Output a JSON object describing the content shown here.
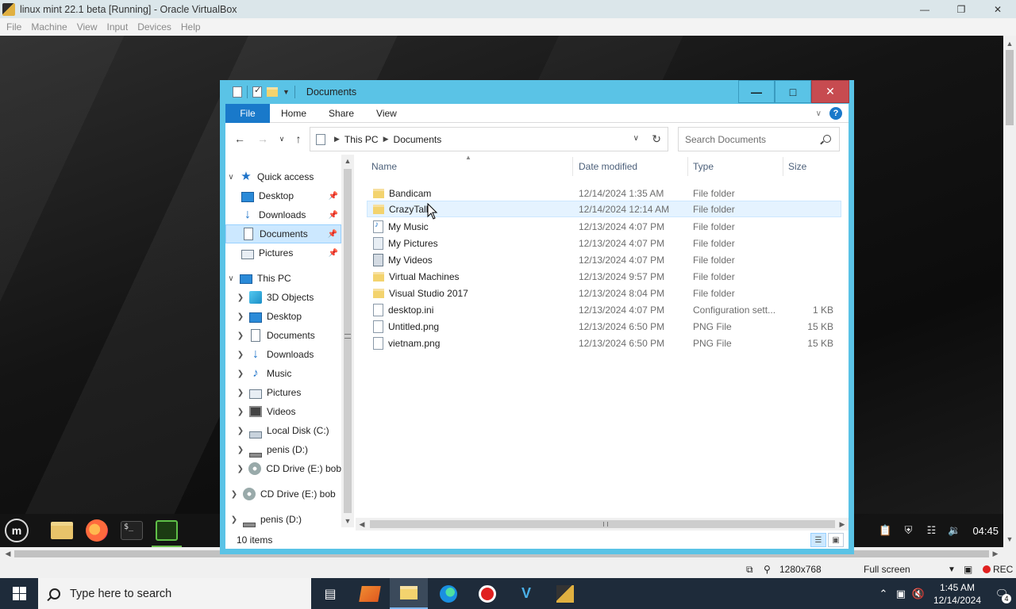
{
  "vbox": {
    "title": "linux mint 22.1 beta [Running] - Oracle VirtualBox",
    "menu": [
      "File",
      "Machine",
      "View",
      "Input",
      "Devices",
      "Help"
    ],
    "status": {
      "resolution": "1280x768",
      "mode": "Full screen",
      "rec": "REC"
    }
  },
  "mint_panel": {
    "clock": "04:45"
  },
  "explorer": {
    "title": "Documents",
    "ribbon_tabs": [
      "File",
      "Home",
      "Share",
      "View"
    ],
    "breadcrumb": [
      "This PC",
      "Documents"
    ],
    "search_placeholder": "Search Documents",
    "nav": [
      {
        "label": "Quick access"
      },
      {
        "label": "Desktop"
      },
      {
        "label": "Downloads"
      },
      {
        "label": "Documents"
      },
      {
        "label": "Pictures"
      },
      {
        "label": "This PC"
      },
      {
        "label": "3D Objects"
      },
      {
        "label": "Desktop"
      },
      {
        "label": "Documents"
      },
      {
        "label": "Downloads"
      },
      {
        "label": "Music"
      },
      {
        "label": "Pictures"
      },
      {
        "label": "Videos"
      },
      {
        "label": "Local Disk (C:)"
      },
      {
        "label": "penis (D:)"
      },
      {
        "label": "CD Drive (E:) bob"
      },
      {
        "label": "CD Drive (E:) bob"
      },
      {
        "label": "penis (D:)"
      }
    ],
    "columns": [
      "Name",
      "Date modified",
      "Type",
      "Size"
    ],
    "files": [
      {
        "name": "Bandicam",
        "date": "12/14/2024 1:35 AM",
        "type": "File folder",
        "size": "",
        "icon": "folder"
      },
      {
        "name": "CrazyTalk",
        "date": "12/14/2024 12:14 AM",
        "type": "File folder",
        "size": "",
        "icon": "folder"
      },
      {
        "name": "My Music",
        "date": "12/13/2024 4:07 PM",
        "type": "File folder",
        "size": "",
        "icon": "music"
      },
      {
        "name": "My Pictures",
        "date": "12/13/2024 4:07 PM",
        "type": "File folder",
        "size": "",
        "icon": "pics"
      },
      {
        "name": "My Videos",
        "date": "12/13/2024 4:07 PM",
        "type": "File folder",
        "size": "",
        "icon": "vids"
      },
      {
        "name": "Virtual Machines",
        "date": "12/13/2024 9:57 PM",
        "type": "File folder",
        "size": "",
        "icon": "folder"
      },
      {
        "name": "Visual Studio 2017",
        "date": "12/13/2024 8:04 PM",
        "type": "File folder",
        "size": "",
        "icon": "folder"
      },
      {
        "name": "desktop.ini",
        "date": "12/13/2024 4:07 PM",
        "type": "Configuration sett...",
        "size": "1 KB",
        "icon": "file"
      },
      {
        "name": "Untitled.png",
        "date": "12/13/2024 6:50 PM",
        "type": "PNG File",
        "size": "15 KB",
        "icon": "file"
      },
      {
        "name": "vietnam.png",
        "date": "12/13/2024 6:50 PM",
        "type": "PNG File",
        "size": "15 KB",
        "icon": "file"
      }
    ],
    "status_count": "10 items"
  },
  "taskbar": {
    "search_placeholder": "Type here to search",
    "time": "1:45 AM",
    "date": "12/14/2024",
    "notification_count": "4"
  },
  "colors": {
    "explorer_frame": "#5ac3e6",
    "file_tab": "#1979ca",
    "close_button": "#c74b50",
    "taskbar": "#1e2b3a"
  }
}
